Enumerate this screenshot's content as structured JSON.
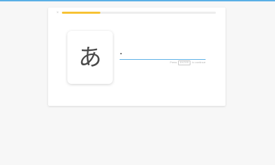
{
  "colors": {
    "accent": "#5ab0e6",
    "progress": "#f7c233",
    "page_bg": "#f7f7f7",
    "card_bg": "#ffffff"
  },
  "header": {
    "close_icon": "close-icon",
    "close_glyph": "×",
    "progress_fraction": 0.25
  },
  "quiz": {
    "character": "あ",
    "answer_value": "",
    "hint": {
      "before": "Press",
      "key": "ENTER",
      "after": "to continue"
    }
  }
}
